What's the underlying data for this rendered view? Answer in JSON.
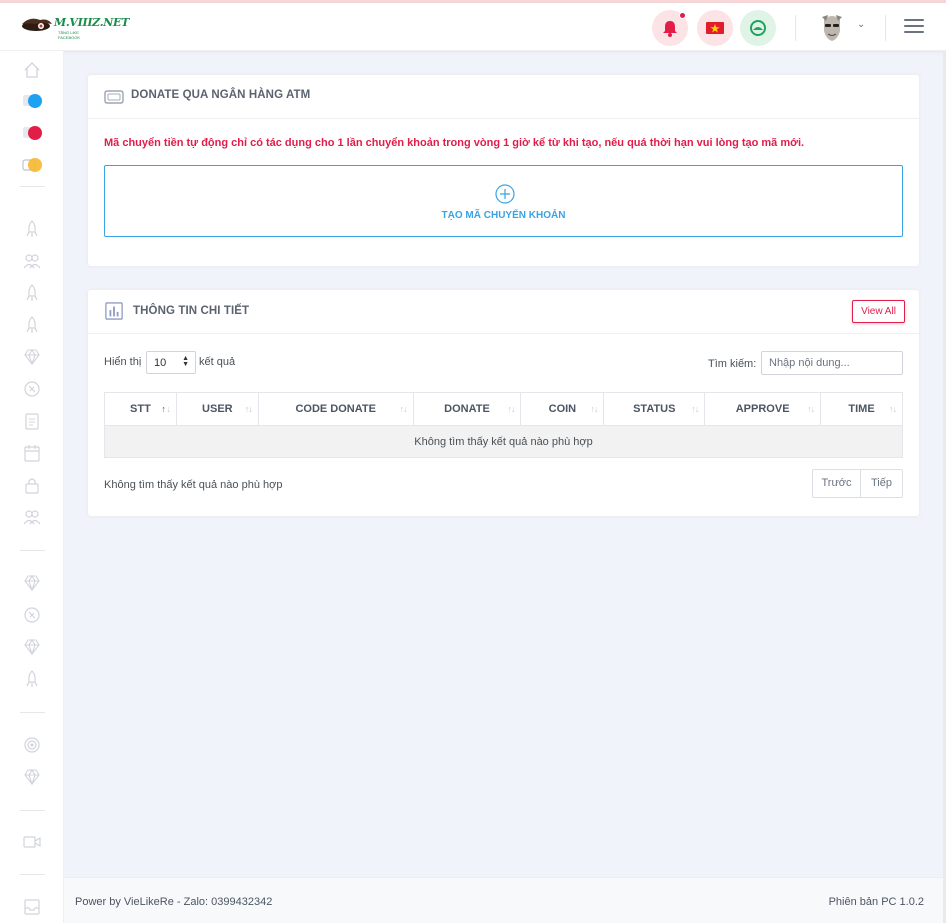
{
  "header": {
    "logo_text": "M.VIIIZ.NET",
    "logo_subtext": "TĂNG LIKE FACEBOOK",
    "icons": [
      "bell-icon",
      "vietnam-flag-icon",
      "wallet-icon",
      "user-avatar",
      "chevron-down-icon",
      "hamburger-menu-icon"
    ],
    "accent_bell": "#e11d48",
    "accent_wallet": "#1fa35c"
  },
  "sidebar": {
    "icons": [
      "home-icon",
      "facebook-icon",
      "instagram-icon",
      "coin-icon",
      "rocket-icon",
      "users-icon",
      "rocket-icon",
      "rocket-icon",
      "diamond-icon",
      "tag-icon",
      "clipboard-icon",
      "calendar-icon",
      "lock-icon",
      "users-icon",
      "diamond-icon",
      "tag-icon",
      "diamond-icon",
      "rocket-icon",
      "target-icon",
      "diamond-icon",
      "video-icon",
      "inbox-icon"
    ]
  },
  "donate_card": {
    "title": "DONATE QUA NGÂN HÀNG ATM",
    "warning": "Mã chuyển tiền tự động chỉ có tác dụng cho 1 lần chuyển khoản trong vòng 1 giờ kể từ khi tạo, nếu quá thời hạn vui lòng tạo mã mới.",
    "create_button": "TẠO MÃ CHUYỂN KHOẢN"
  },
  "detail_card": {
    "title": "THÔNG TIN CHI TIẾT",
    "view_all": "View All",
    "show_label": "Hiển thị",
    "page_size": "10",
    "results_label": "kết quả",
    "search_label": "Tìm kiếm:",
    "search_placeholder": "Nhập nội dung...",
    "columns": [
      "STT",
      "USER",
      "CODE DONATE",
      "DONATE",
      "COIN",
      "STATUS",
      "APPROVE",
      "TIME"
    ],
    "empty_message": "Không tìm thấy kết quả nào phù hợp",
    "info_text": "Không tìm thấy kết quả nào phù hợp",
    "prev_label": "Trước",
    "next_label": "Tiếp"
  },
  "footer": {
    "left": "Power by VieLikeRe - Zalo: 0399432342",
    "right": "Phiên bản PC 1.0.2"
  }
}
